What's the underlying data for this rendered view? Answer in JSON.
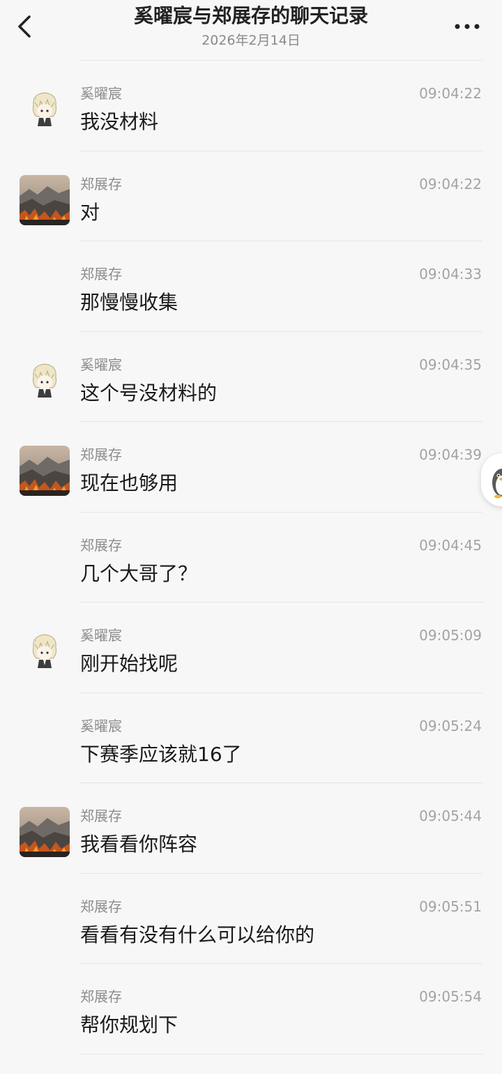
{
  "header": {
    "title": "奚曜宸与郑展存的聊天记录",
    "date": "2026年2月14日",
    "back_icon": "chevron-left-icon",
    "more_icon": "more-dots-icon"
  },
  "messages": [
    {
      "sender": "奚曜宸",
      "time": "09:04:22",
      "text": "我没材料",
      "avatar": "anime-boy"
    },
    {
      "sender": "郑展存",
      "time": "09:04:22",
      "text": "对",
      "avatar": "landscape"
    },
    {
      "sender": "郑展存",
      "time": "09:04:33",
      "text": "那慢慢收集",
      "avatar": ""
    },
    {
      "sender": "奚曜宸",
      "time": "09:04:35",
      "text": "这个号没材料的",
      "avatar": "anime-boy"
    },
    {
      "sender": "郑展存",
      "time": "09:04:39",
      "text": "现在也够用",
      "avatar": "landscape"
    },
    {
      "sender": "郑展存",
      "time": "09:04:45",
      "text": "几个大哥了？",
      "avatar": ""
    },
    {
      "sender": "奚曜宸",
      "time": "09:05:09",
      "text": "刚开始找呢",
      "avatar": "anime-boy"
    },
    {
      "sender": "奚曜宸",
      "time": "09:05:24",
      "text": "下赛季应该就16了",
      "avatar": ""
    },
    {
      "sender": "郑展存",
      "time": "09:05:44",
      "text": "我看看你阵容",
      "avatar": "landscape"
    },
    {
      "sender": "郑展存",
      "time": "09:05:51",
      "text": "看看有没有什么可以给你的",
      "avatar": ""
    },
    {
      "sender": "郑展存",
      "time": "09:05:54",
      "text": "帮你规划下",
      "avatar": ""
    }
  ],
  "floating_button": {
    "icon": "penguin-icon"
  },
  "colors": {
    "background": "#f7f7f7",
    "divider": "#e6e6e6",
    "text": "#1a1a1a",
    "meta": "#8c8c8c"
  }
}
